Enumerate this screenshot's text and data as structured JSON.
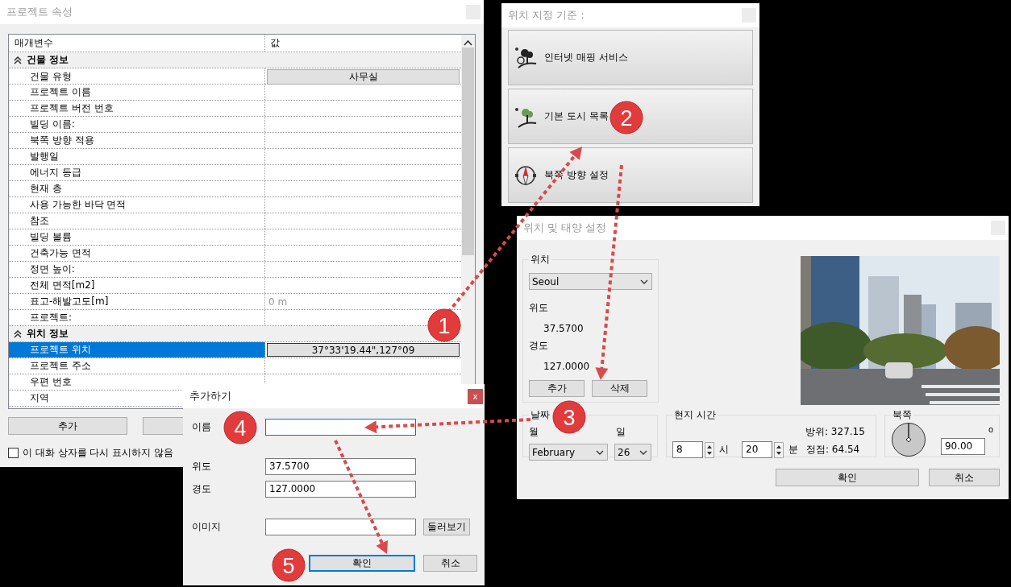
{
  "project_properties": {
    "title": "프로젝트 속성",
    "columns": [
      "매개변수",
      "값"
    ],
    "groups": [
      {
        "label": "건물 정보",
        "expanded": true,
        "rows": [
          {
            "name": "건물 유형",
            "value": "사무실",
            "kind": "button",
            "selected": false
          },
          {
            "name": "프로젝트 이름",
            "kind": "plain",
            "selected": false
          },
          {
            "name": "프로젝트 버전 번호",
            "kind": "plain",
            "selected": false
          },
          {
            "name": "빌딩 이름:",
            "kind": "plain",
            "selected": false
          },
          {
            "name": "북쪽 방향 적용",
            "kind": "plain",
            "selected": false
          },
          {
            "name": "발행일",
            "kind": "plain",
            "selected": false
          },
          {
            "name": "에너지 등급",
            "kind": "plain",
            "selected": false
          },
          {
            "name": "현재 층",
            "kind": "plain",
            "selected": false
          },
          {
            "name": "사용 가능한 바닥 면적",
            "kind": "plain",
            "selected": false
          },
          {
            "name": "참조",
            "kind": "plain",
            "selected": false
          },
          {
            "name": "빌딩 볼륨",
            "kind": "plain",
            "selected": false
          },
          {
            "name": "건축가능 면적",
            "kind": "plain",
            "selected": false
          },
          {
            "name": "정면 높이:",
            "kind": "plain",
            "selected": false
          },
          {
            "name": "전체 면적[m2]",
            "kind": "plain",
            "selected": false
          },
          {
            "name": "표고-해발고도[m]",
            "value": "0 m",
            "kind": "muted",
            "selected": false
          },
          {
            "name": "프로젝트:",
            "kind": "plain",
            "selected": false
          }
        ]
      },
      {
        "label": "위치 정보",
        "expanded": true,
        "rows": [
          {
            "name": "프로젝트 위치",
            "value": "37°33'19.44\",127°09",
            "kind": "button",
            "selected": true
          },
          {
            "name": "프로젝트 주소",
            "kind": "plain",
            "selected": false
          },
          {
            "name": "우편 번호",
            "kind": "plain",
            "selected": false
          },
          {
            "name": "지역",
            "kind": "plain",
            "selected": false
          }
        ]
      }
    ],
    "buttons": [
      "추가"
    ],
    "dont_show_again": {
      "label": "이 대화 상자를 다시 표시하지 않음",
      "checked": false
    }
  },
  "location_source": {
    "title": "위치 지정 기준 :",
    "options": [
      {
        "label": "인터넷 매핑 서비스",
        "kind": "internet"
      },
      {
        "label": "기본 도시 목록",
        "kind": "city"
      },
      {
        "label": "북쪽 방향 설정",
        "kind": "north"
      }
    ]
  },
  "location_and_sun": {
    "title": "위치 및 태양 설정",
    "location": {
      "legend": "위치",
      "city": "Seoul",
      "latitude_label": "위도",
      "latitude": "37.5700",
      "longitude_label": "경도",
      "longitude": "127.0000",
      "buttons": [
        "추가",
        "삭제"
      ]
    },
    "photo": {
      "kind": "picture"
    },
    "date": {
      "legend": "날짜",
      "month_label": "월",
      "day_label": "일",
      "month": "February",
      "day": "26"
    },
    "local_time": {
      "legend": "현지 시간",
      "hour": "8",
      "hour_unit": "시",
      "minute": "20",
      "minute_unit": "분",
      "azimuth": "방위: 327.15",
      "altitude": "정점: 64.54"
    },
    "north": {
      "legend": "북쪽",
      "angle": "90.00",
      "degree_mark": "o"
    },
    "buttons": [
      "확인",
      "취소"
    ]
  },
  "add_location": {
    "title": "추가하기",
    "close": "x",
    "fields": [
      {
        "label": "이름",
        "focused": true
      },
      {
        "label": "위도",
        "value": "37.5700",
        "focused": false
      },
      {
        "label": "경도",
        "value": "127.0000",
        "focused": false
      },
      {
        "label": "이미지",
        "focused": false,
        "button": "둘러보기"
      }
    ],
    "buttons": [
      {
        "label": "확인",
        "default": true
      },
      {
        "label": "취소",
        "default": false
      }
    ]
  },
  "steps": [
    {
      "label": "1"
    },
    {
      "label": "2"
    },
    {
      "label": "3"
    },
    {
      "label": "4"
    },
    {
      "label": "5"
    }
  ]
}
